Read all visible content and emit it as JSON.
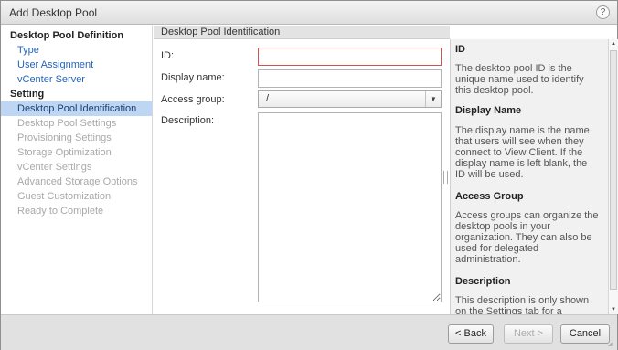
{
  "dialog": {
    "title": "Add Desktop Pool",
    "help_icon": "?"
  },
  "nav": {
    "sections": [
      {
        "heading": "Desktop Pool Definition"
      },
      {
        "heading": "Setting"
      }
    ],
    "items": [
      {
        "label": "Type",
        "state": "link"
      },
      {
        "label": "User Assignment",
        "state": "link"
      },
      {
        "label": "vCenter Server",
        "state": "link"
      },
      {
        "label": "Desktop Pool Identification",
        "state": "active"
      },
      {
        "label": "Desktop Pool Settings",
        "state": "disabled"
      },
      {
        "label": "Provisioning Settings",
        "state": "disabled"
      },
      {
        "label": "Storage Optimization",
        "state": "disabled"
      },
      {
        "label": "vCenter Settings",
        "state": "disabled"
      },
      {
        "label": "Advanced Storage Options",
        "state": "disabled"
      },
      {
        "label": "Guest Customization",
        "state": "disabled"
      },
      {
        "label": "Ready to Complete",
        "state": "disabled"
      }
    ]
  },
  "form": {
    "header": "Desktop Pool Identification",
    "id_label": "ID:",
    "id_value": "",
    "display_name_label": "Display name:",
    "display_name_value": "",
    "access_group_label": "Access group:",
    "access_group_value": "/",
    "description_label": "Description:",
    "description_value": ""
  },
  "help": {
    "sections": [
      {
        "title": "ID",
        "lines": [
          "The desktop pool ID is the",
          "unique name used to identify",
          "this desktop pool."
        ]
      },
      {
        "title": "Display Name",
        "lines": [
          "The display name is the name",
          "that users will see when they",
          "connect to View Client. If the",
          "display name is left blank, the",
          "ID will be used."
        ]
      },
      {
        "title": "Access Group",
        "lines": [
          "Access groups can organize the",
          "desktop pools in your",
          "organization. They can also be",
          "used for delegated",
          "administration."
        ]
      },
      {
        "title": "Description",
        "lines": [
          "This description is only shown",
          "on the Settings tab for a"
        ]
      }
    ]
  },
  "footer": {
    "back_label": "< Back",
    "next_label": "Next >",
    "cancel_label": "Cancel"
  },
  "colors": {
    "active_nav_bg": "#bcd6f3",
    "link": "#2564b8",
    "error_border": "#d25252"
  }
}
